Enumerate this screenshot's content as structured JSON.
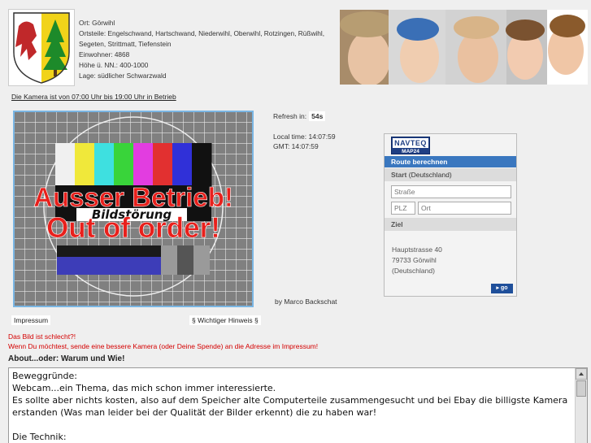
{
  "location": {
    "ort": "Ort: Görwihl",
    "ortsteile_1": "Ortsteile: Engelschwand, Hartschwand, Niederwihl, Oberwihl, Rotzingen, Rüßwihl,",
    "ortsteile_2": "Segeten, Strittmatt, Tiefenstein",
    "einwohner": "Einwohner: 4868",
    "hoehe": "Höhe ü. NN.: 400-1000",
    "lage": "Lage: südlicher Schwarzwald"
  },
  "camera": {
    "hours_link": "Die Kamera ist von 07:00 Uhr bis 19:00 Uhr in Betrieb",
    "overlay_de": "Ausser Betrieb!",
    "overlay_strip": "Bildstörung",
    "overlay_en": "Out of order!",
    "testcard_colors": [
      "#f0f0f0",
      "#f0e83a",
      "#3ee0e0",
      "#39d43a",
      "#e23de0",
      "#e23030",
      "#3030d8",
      "#111111"
    ]
  },
  "status": {
    "refresh_label": "Refresh in:",
    "refresh_value": "54s",
    "local_time": "Local time: 14:07:59",
    "gmt_time": "GMT: 14:07:59",
    "byline": "by Marco Backschat"
  },
  "route": {
    "logo_top": "NAVTEQ",
    "logo_bottom": "MAP24",
    "header": "Route berechnen",
    "start_label": "Start",
    "start_country": "(Deutschland)",
    "street_placeholder": "Straße",
    "plz_placeholder": "PLZ",
    "ort_placeholder": "Ort",
    "ziel_label": "Ziel",
    "address_1": "Hauptstrasse 40",
    "address_2": "79733 Görwihl",
    "address_3": "(Deutschland)",
    "go_label": "go"
  },
  "links": {
    "impressum": "Impressum",
    "hinweis": "§ Wichtiger Hinweis §"
  },
  "notice": {
    "line1": "Das Bild ist schlecht?!",
    "line2": "Wenn Du möchtest, sende eine bessere Kamera (oder Deine Spende) an die Adresse im Impressum!"
  },
  "about": {
    "heading": "About...oder: Warum und Wie!",
    "text": "Beweggründe:\nWebcam...ein Thema, das mich schon immer interessierte.\nEs sollte aber nichts kosten, also auf dem Speicher alte Computerteile zusammengesucht und bei Ebay die billigste Kamera erstanden (Was man leider bei der Qualität der Bilder erkennt) die zu haben war!\n\nDie Technik:"
  }
}
